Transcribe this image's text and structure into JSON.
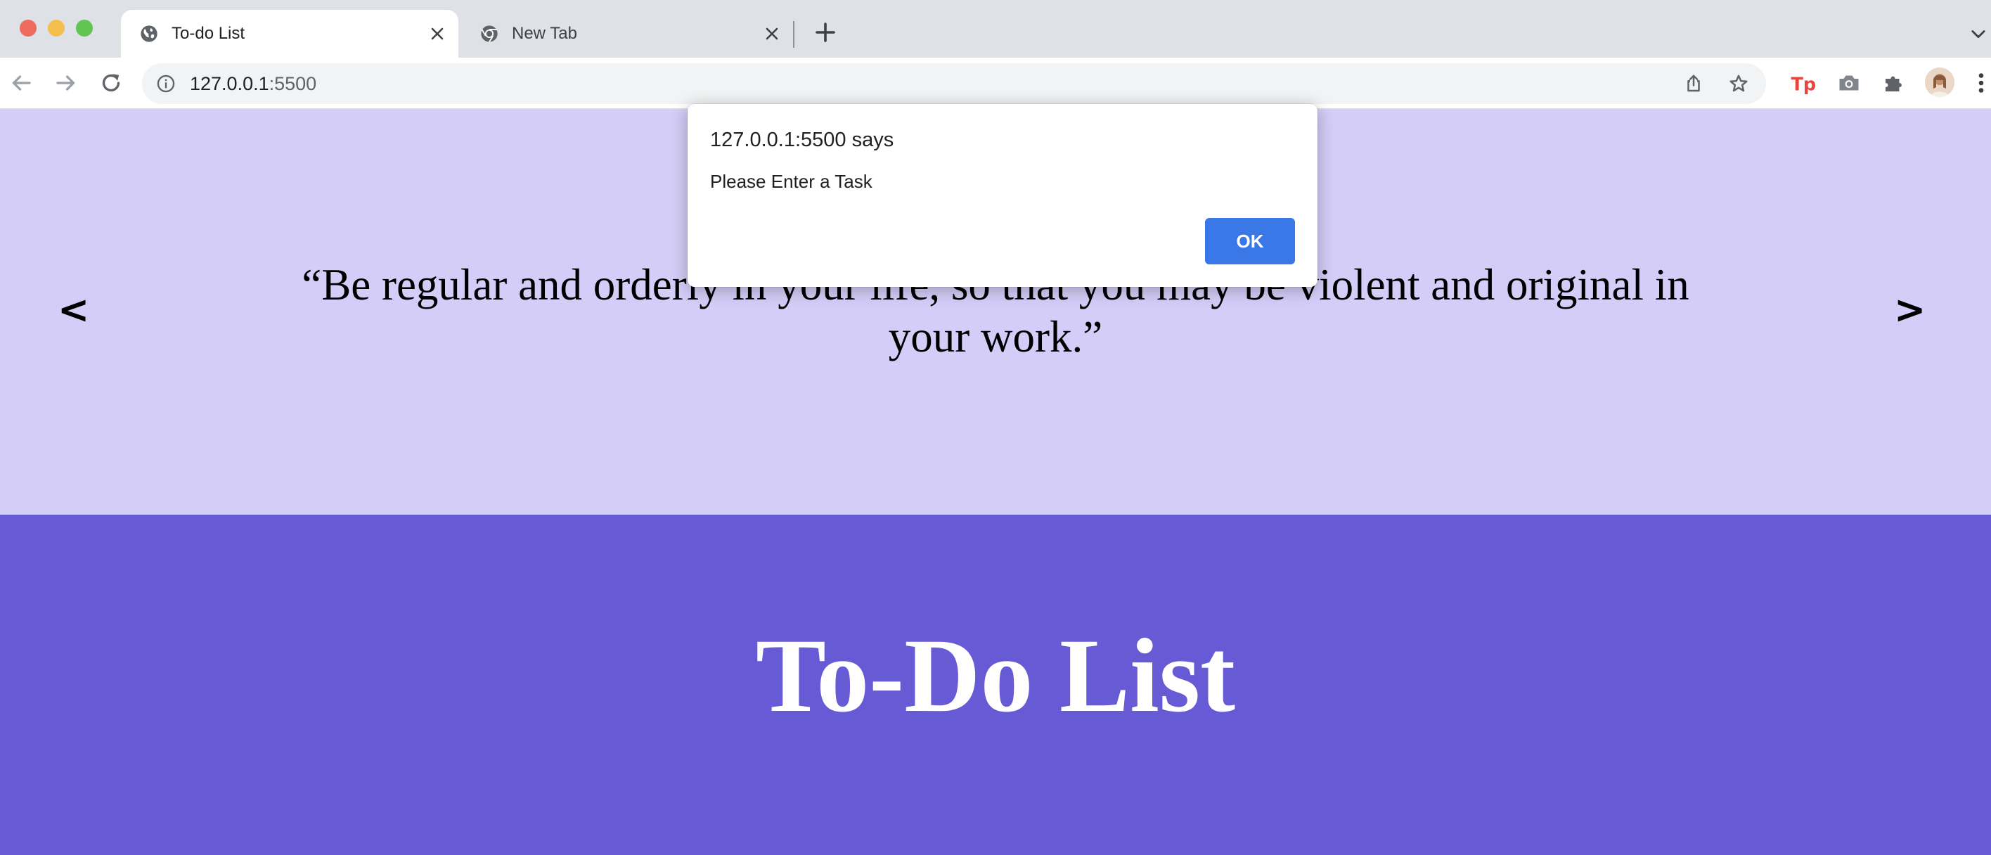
{
  "browser": {
    "tabs": [
      {
        "title": "To-do List",
        "active": true,
        "icon": "globe-icon"
      },
      {
        "title": "New Tab",
        "active": false,
        "icon": "chrome-icon"
      }
    ],
    "address_bar": {
      "host": "127.0.0.1",
      "port": ":5500"
    },
    "extensions": [
      "tp-extension-icon",
      "camera-icon",
      "puzzle-icon"
    ]
  },
  "page": {
    "quote": {
      "text": "“Be regular and orderly in your life, so that you may be violent and original in your work.”",
      "prev_label": "<",
      "next_label": ">"
    },
    "todo": {
      "title": "To-Do List"
    }
  },
  "alert": {
    "origin": "127.0.0.1:5500 says",
    "message": "Please Enter a Task",
    "ok_label": "OK"
  },
  "colors": {
    "quote_bg": "#d4cdf7",
    "todo_bg": "#675ad5",
    "ok_button": "#3b78e7",
    "tp_extension": "#e8453c"
  }
}
